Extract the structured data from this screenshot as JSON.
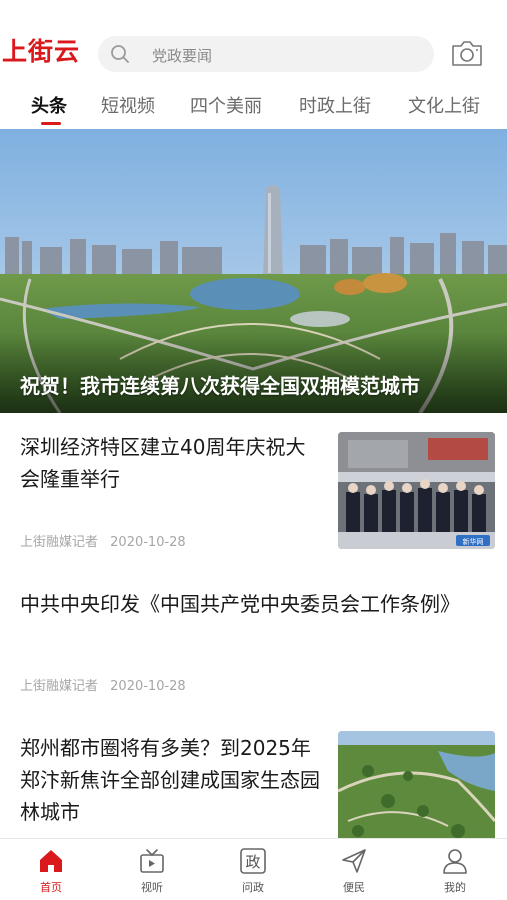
{
  "header": {
    "logo_text": "上街云",
    "search_placeholder": "党政要闻"
  },
  "tabs": [
    {
      "label": "头条",
      "active": true
    },
    {
      "label": "短视频",
      "active": false
    },
    {
      "label": "四个美丽",
      "active": false
    },
    {
      "label": "时政上街",
      "active": false
    },
    {
      "label": "文化上街",
      "active": false
    }
  ],
  "hero": {
    "caption": "祝贺！我市连续第八次获得全国双拥模范城市"
  },
  "news": [
    {
      "title": "深圳经济特区建立40周年庆祝大会隆重举行",
      "source": "上街融媒记者",
      "date": "2020-10-28",
      "thumb_badge": "新华网"
    },
    {
      "title": "中共中央印发《中国共产党中央委员会工作条例》",
      "source": "上街融媒记者",
      "date": "2020-10-28"
    },
    {
      "title": "郑州都市圈将有多美？到2025年郑汴新焦许全部创建成国家生态园林城市",
      "source": "",
      "date": ""
    }
  ],
  "bottom_nav": [
    {
      "label": "首页",
      "icon": "home-icon",
      "active": true
    },
    {
      "label": "视听",
      "icon": "tv-icon",
      "active": false
    },
    {
      "label": "问政",
      "icon": "zheng-icon",
      "active": false
    },
    {
      "label": "便民",
      "icon": "send-icon",
      "active": false
    },
    {
      "label": "我的",
      "icon": "user-icon",
      "active": false
    }
  ],
  "colors": {
    "accent": "#d9191c",
    "text_primary": "#1a1a1a",
    "text_muted": "#a6a6a6",
    "tab_inactive": "#6b6b6b"
  }
}
